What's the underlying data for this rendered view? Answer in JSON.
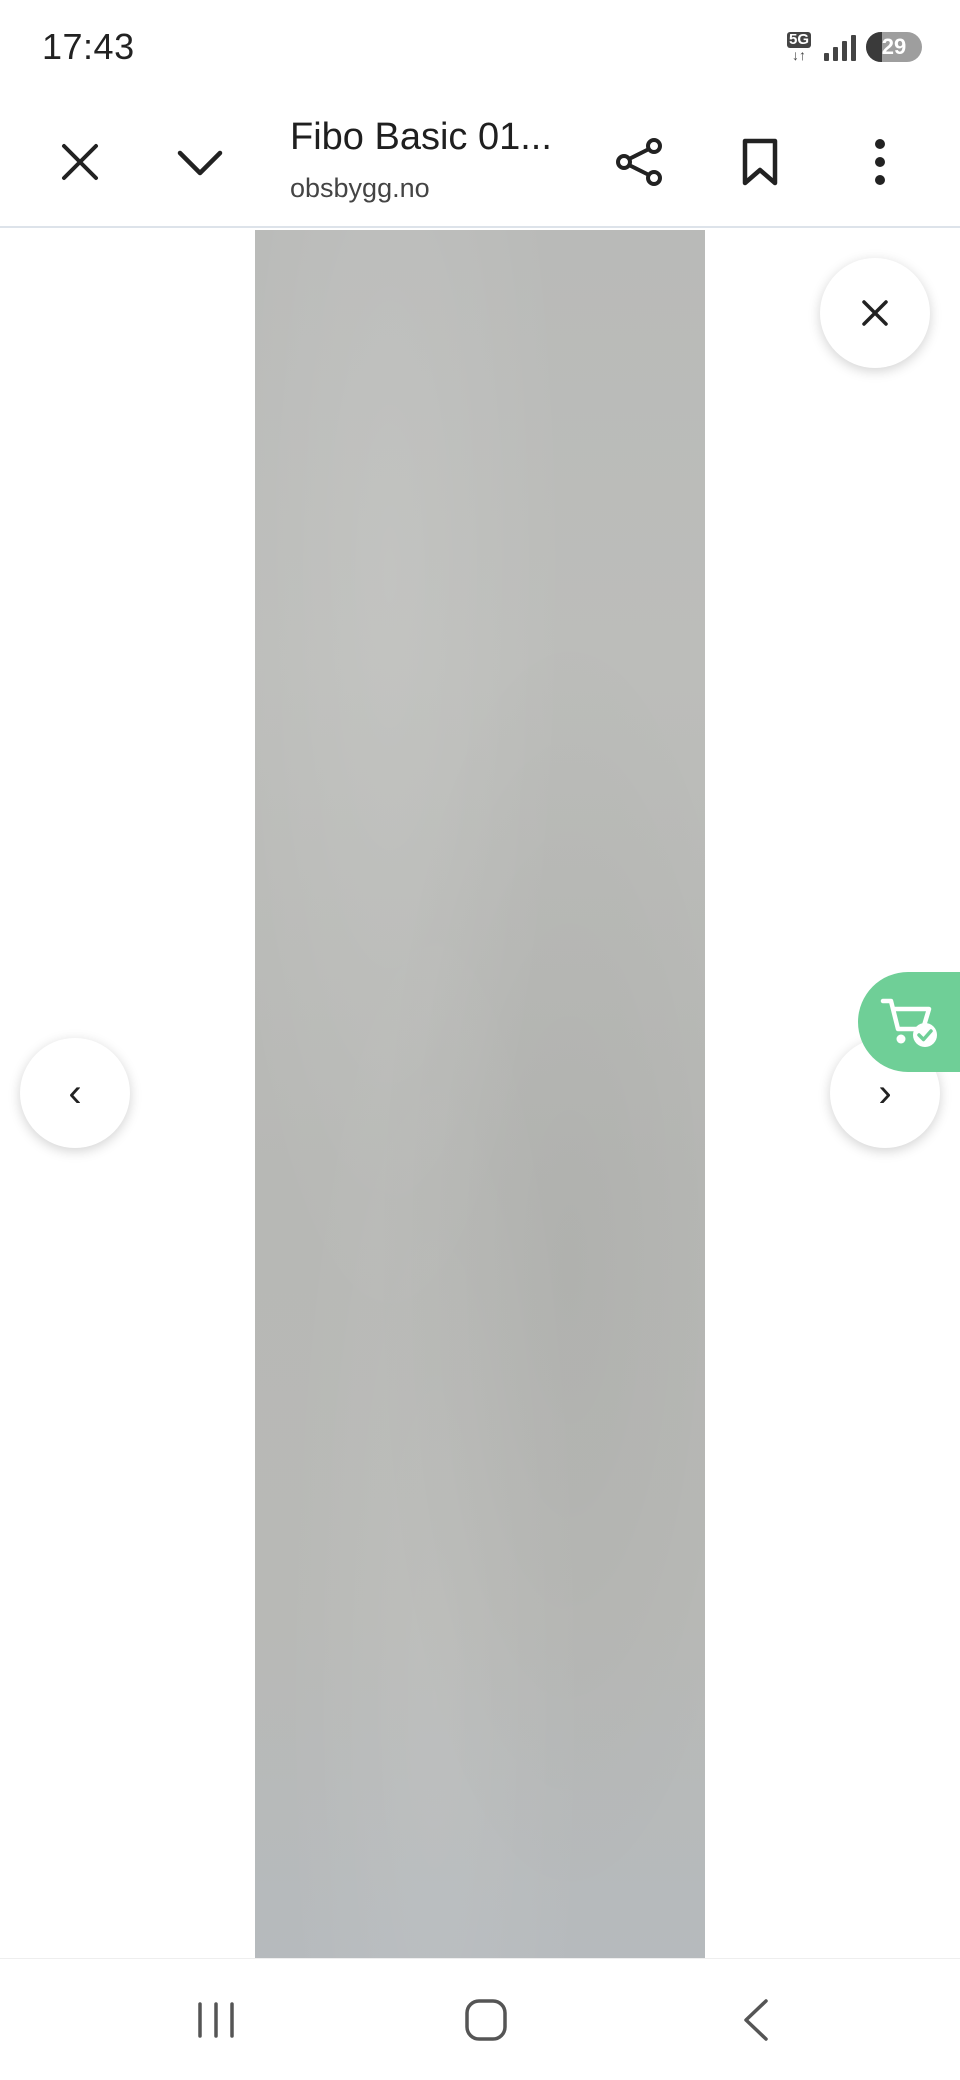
{
  "status_bar": {
    "time": "17:43",
    "network": "5G",
    "battery": "29"
  },
  "toolbar": {
    "title": "Fibo Basic 01...",
    "url": "obsbygg.no",
    "icons": [
      "close-icon",
      "chevron-down-icon",
      "share-icon",
      "bookmark-icon",
      "more-vert-icon"
    ]
  },
  "lightbox": {
    "prev_label": "‹",
    "next_label": "›",
    "close_icon": "close-icon",
    "cart_icon": "cart-check-icon",
    "cart_color": "#6fcf97",
    "image_color": "#b8b9b6"
  },
  "nav": {
    "icons": [
      "recent-apps-icon",
      "home-icon",
      "back-icon"
    ]
  }
}
